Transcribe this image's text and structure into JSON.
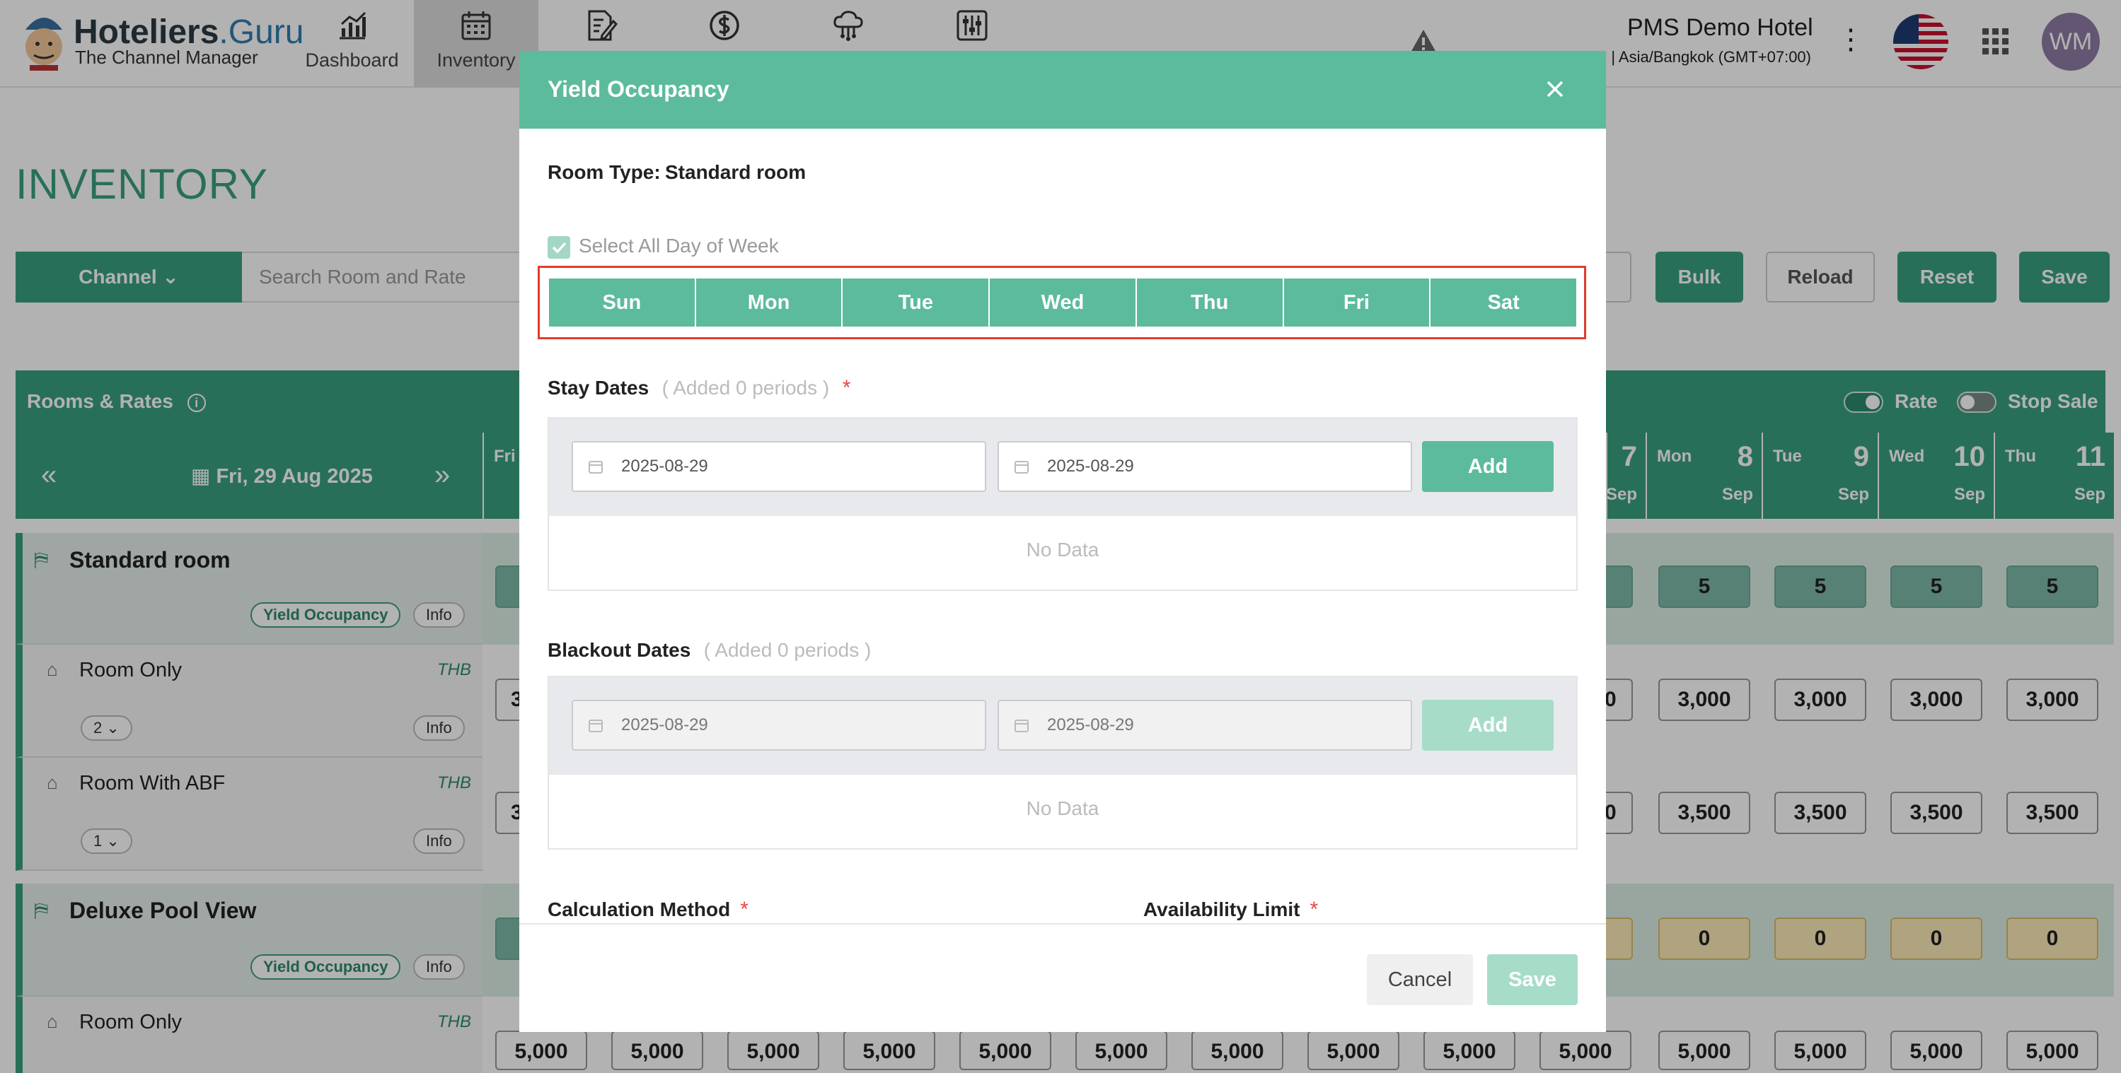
{
  "app": {
    "brand_main": "Hoteliers",
    "brand_accent": ".Guru",
    "brand_sub": "The Channel Manager",
    "hotel_name": "PMS Demo Hotel",
    "timezone": "| Asia/Bangkok (GMT+07:00)",
    "avatar_initials": "WM",
    "accent_color": "#3aa082"
  },
  "nav": {
    "items": [
      {
        "label": "Dashboard",
        "icon": "bar-chart-icon"
      },
      {
        "label": "Inventory",
        "icon": "calendar-icon",
        "active": true
      },
      {
        "label": "",
        "icon": "document-edit-icon"
      },
      {
        "label": "",
        "icon": "dollar-icon"
      },
      {
        "label": "",
        "icon": "cloud-network-icon"
      },
      {
        "label": "",
        "icon": "sliders-icon"
      }
    ]
  },
  "page": {
    "title": "INVENTORY",
    "channel_label": "Channel",
    "search_placeholder": "Search Room and Rate",
    "buttons": {
      "bulk": "Bulk",
      "reload": "Reload",
      "reset": "Reset",
      "save": "Save"
    },
    "rooms_rates_label": "Rooms & Rates",
    "toggle_rate": "Rate",
    "toggle_stop_sale": "Stop Sale",
    "current_date": "Fri, 29 Aug 2025",
    "first_col_day": "Fri",
    "columns": [
      {
        "dow": "",
        "day": "7",
        "month": "Sep"
      },
      {
        "dow": "Mon",
        "day": "8",
        "month": "Sep"
      },
      {
        "dow": "Tue",
        "day": "9",
        "month": "Sep"
      },
      {
        "dow": "Wed",
        "day": "10",
        "month": "Sep"
      },
      {
        "dow": "Thu",
        "day": "11",
        "month": "Sep"
      }
    ],
    "rooms": [
      {
        "name": "Standard room",
        "yield_label": "Yield Occupancy",
        "info_label": "Info",
        "availability": [
          "5",
          "5",
          "5",
          "5"
        ],
        "rates": [
          {
            "name": "Room Only",
            "currency": "THB",
            "qty": "2",
            "info": "Info",
            "edge_left": "3",
            "edge_right": "0",
            "prices": [
              "3,000",
              "3,000",
              "3,000",
              "3,000"
            ]
          },
          {
            "name": "Room With ABF",
            "currency": "THB",
            "qty": "1",
            "info": "Info",
            "edge_left": "3",
            "edge_right": "0",
            "prices": [
              "3,500",
              "3,500",
              "3,500",
              "3,500"
            ]
          }
        ]
      },
      {
        "name": "Deluxe Pool View",
        "yield_label": "Yield Occupancy",
        "info_label": "Info",
        "availability": [
          "0",
          "0",
          "0",
          "0"
        ],
        "rates": [
          {
            "name": "Room Only",
            "currency": "THB",
            "prices": [
              "5,000",
              "5,000",
              "5,000",
              "5,000",
              "5,000",
              "5,000",
              "5,000",
              "5,000",
              "5,000",
              "5,000",
              "5,000",
              "5,000",
              "5,000",
              "5,000"
            ]
          }
        ]
      }
    ]
  },
  "modal": {
    "title": "Yield Occupancy",
    "room_type_label": "Room Type:",
    "room_type_value": "Standard room",
    "select_all_label": "Select All Day of Week",
    "days": [
      "Sun",
      "Mon",
      "Tue",
      "Wed",
      "Thu",
      "Fri",
      "Sat"
    ],
    "stay_dates": {
      "label": "Stay Dates",
      "added": "( Added 0 periods )",
      "from": "2025-08-29",
      "to": "2025-08-29",
      "add_label": "Add",
      "empty": "No Data"
    },
    "blackout_dates": {
      "label": "Blackout Dates",
      "added": "( Added 0 periods )",
      "from": "2025-08-29",
      "to": "2025-08-29",
      "add_label": "Add",
      "empty": "No Data"
    },
    "calculation_method_label": "Calculation Method",
    "availability_limit_label": "Availability Limit",
    "required_mark": "*",
    "cancel_label": "Cancel",
    "save_label": "Save"
  }
}
